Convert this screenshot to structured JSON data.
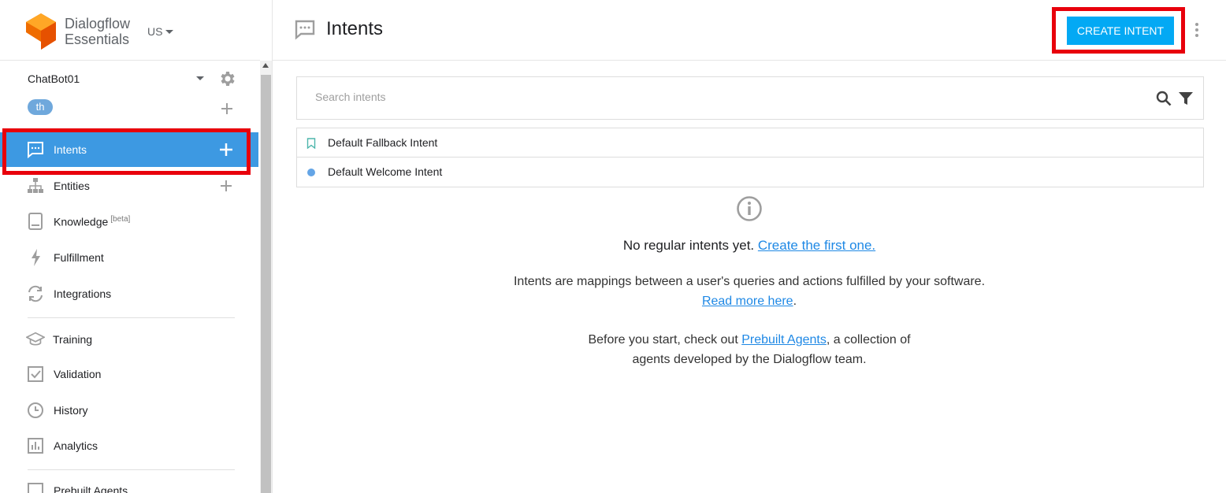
{
  "brand": {
    "line1": "Dialogflow",
    "line2": "Essentials",
    "logo_icon": "dialogflow-logo",
    "logo_color": "#ef6c00"
  },
  "region": {
    "label": "US"
  },
  "agent": {
    "name": "ChatBot01",
    "language_chip": "th"
  },
  "sidebar": {
    "items": [
      {
        "label": "Intents",
        "icon": "intents-icon",
        "active": true,
        "has_add": true
      },
      {
        "label": "Entities",
        "icon": "entities-icon",
        "has_add": true
      },
      {
        "label": "Knowledge",
        "badge": "[beta]",
        "icon": "knowledge-icon"
      },
      {
        "label": "Fulfillment",
        "icon": "fulfillment-icon"
      },
      {
        "label": "Integrations",
        "icon": "integrations-icon"
      },
      {
        "label": "Training",
        "icon": "training-icon"
      },
      {
        "label": "Validation",
        "icon": "validation-icon"
      },
      {
        "label": "History",
        "icon": "history-icon"
      },
      {
        "label": "Analytics",
        "icon": "analytics-icon"
      },
      {
        "label": "Prebuilt Agents",
        "icon": "prebuilt-agents-icon"
      }
    ],
    "active_color": "#3d99e2"
  },
  "header": {
    "title": "Intents",
    "create_button": "CREATE INTENT",
    "button_color": "#03a9f4"
  },
  "search": {
    "placeholder": "Search intents"
  },
  "intents": [
    {
      "name": "Default Fallback Intent",
      "marker": "bookmark-outline-icon"
    },
    {
      "name": "Default Welcome Intent",
      "marker": "dot-icon"
    }
  ],
  "empty_state": {
    "heading": "No regular intents yet. ",
    "heading_link": "Create the first one.",
    "p1_text": "Intents are mappings between a user's queries and actions fulfilled by your software. ",
    "p1_link": "Read more here",
    "p1_end": ".",
    "p2_text": "Before you start, check out ",
    "p2_link": "Prebuilt Agents",
    "p2_end": ", a collection of agents developed by the Dialogflow team."
  },
  "highlight_color": "#e8000b"
}
